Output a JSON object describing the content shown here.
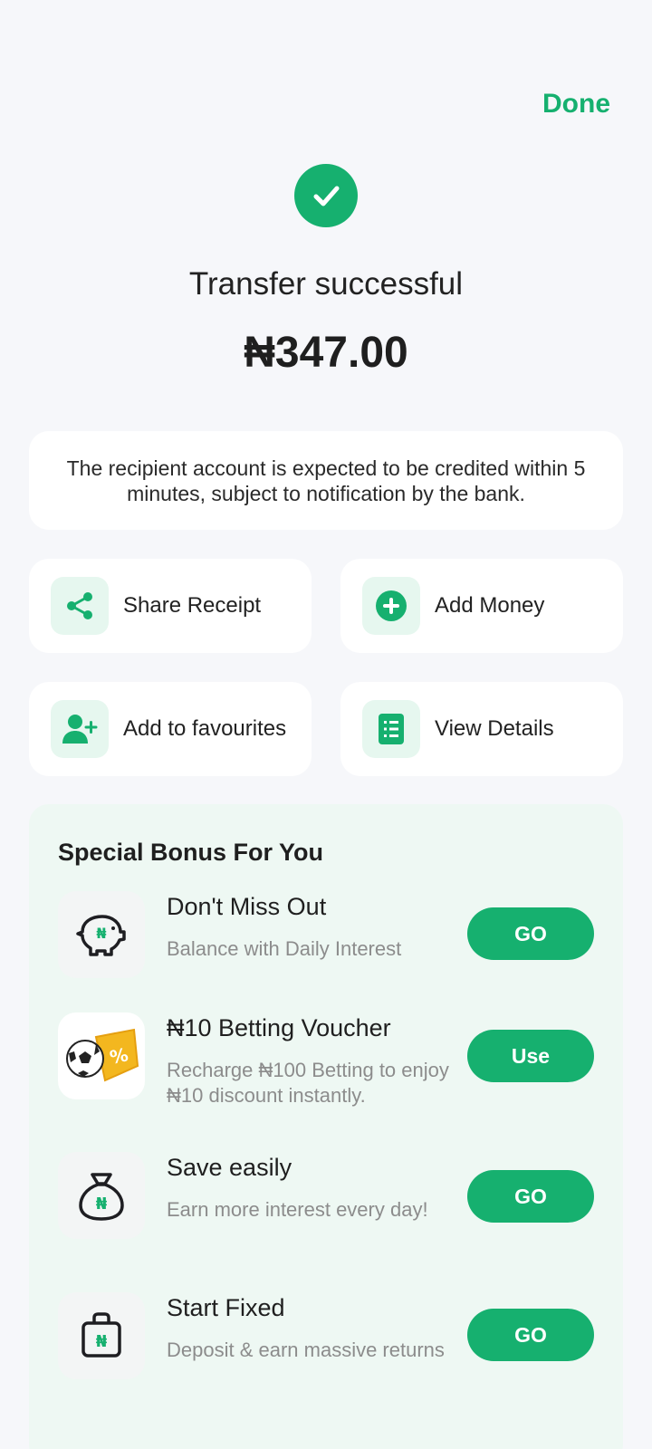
{
  "header": {
    "done_label": "Done"
  },
  "status": {
    "icon": "check-icon",
    "title": "Transfer successful",
    "amount": "₦347.00"
  },
  "notice": "The recipient account is expected to be credited within 5 minutes, subject to notification by the bank.",
  "actions": [
    {
      "label": "Share Receipt",
      "icon": "share-icon"
    },
    {
      "label": "Add Money",
      "icon": "plus-circle-icon"
    },
    {
      "label": "Add to favourites",
      "icon": "add-user-icon"
    },
    {
      "label": "View Details",
      "icon": "list-icon"
    }
  ],
  "bonus": {
    "title": "Special Bonus For You",
    "offers": [
      {
        "title": "Don't Miss Out",
        "subtitle": "Balance with Daily Interest",
        "button": "GO",
        "icon": "piggy-bank-icon"
      },
      {
        "title": "₦10 Betting Voucher",
        "subtitle": "Recharge ₦100 Betting to enjoy ₦10 discount instantly.",
        "button": "Use",
        "icon": "soccer-voucher-icon"
      },
      {
        "title": "Save easily",
        "subtitle": "Earn more interest every day!",
        "button": "GO",
        "icon": "money-bag-icon"
      },
      {
        "title": "Start Fixed",
        "subtitle": "Deposit & earn massive returns",
        "button": "GO",
        "icon": "safe-box-icon"
      }
    ]
  },
  "colors": {
    "accent": "#16b06f",
    "accent_light": "#e6f7ef",
    "bonus_bg": "#eef8f3"
  }
}
